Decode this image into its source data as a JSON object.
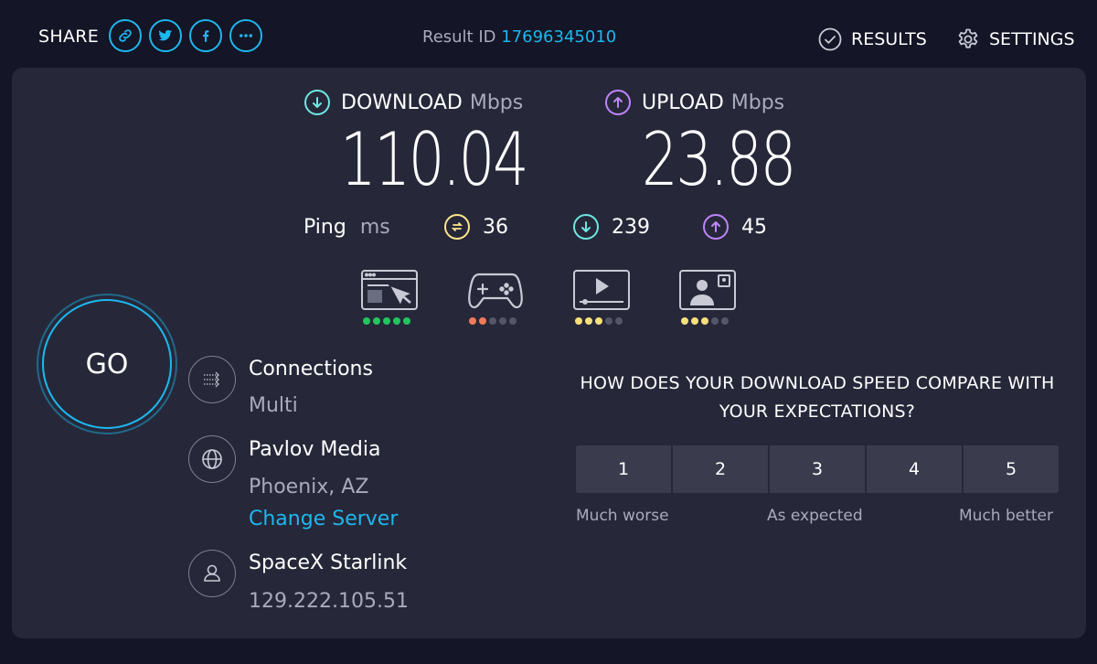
{
  "header": {
    "share_label": "SHARE",
    "result_label": "Result ID",
    "result_id": "17696345010",
    "results_label": "RESULTS",
    "settings_label": "SETTINGS"
  },
  "download": {
    "label": "DOWNLOAD",
    "unit": "Mbps",
    "value": "110.04"
  },
  "upload": {
    "label": "UPLOAD",
    "unit": "Mbps",
    "value": "23.88"
  },
  "ping": {
    "label": "Ping",
    "unit": "ms",
    "idle": "36",
    "download": "239",
    "upload": "45"
  },
  "ratings": [
    {
      "name": "browsing",
      "filled": 5,
      "color": "#22c55e"
    },
    {
      "name": "gaming",
      "filled": 2,
      "color": "#f07b5a"
    },
    {
      "name": "streaming",
      "filled": 3,
      "color": "#f7e07a"
    },
    {
      "name": "video-calling",
      "filled": 3,
      "color": "#f7e07a"
    }
  ],
  "go_label": "GO",
  "connections": {
    "title": "Connections",
    "value": "Multi"
  },
  "server": {
    "name": "Pavlov Media",
    "location": "Phoenix, AZ",
    "change_label": "Change Server"
  },
  "provider": {
    "name": "SpaceX Starlink",
    "ip": "129.222.105.51"
  },
  "survey": {
    "question": "HOW DOES YOUR DOWNLOAD SPEED COMPARE WITH YOUR EXPECTATIONS?",
    "options": [
      "1",
      "2",
      "3",
      "4",
      "5"
    ],
    "low_label": "Much worse",
    "mid_label": "As expected",
    "high_label": "Much better"
  },
  "colors": {
    "accent": "#1db7ee",
    "download": "#6ee7e3",
    "upload": "#c084fc",
    "ping": "#fde68a"
  }
}
